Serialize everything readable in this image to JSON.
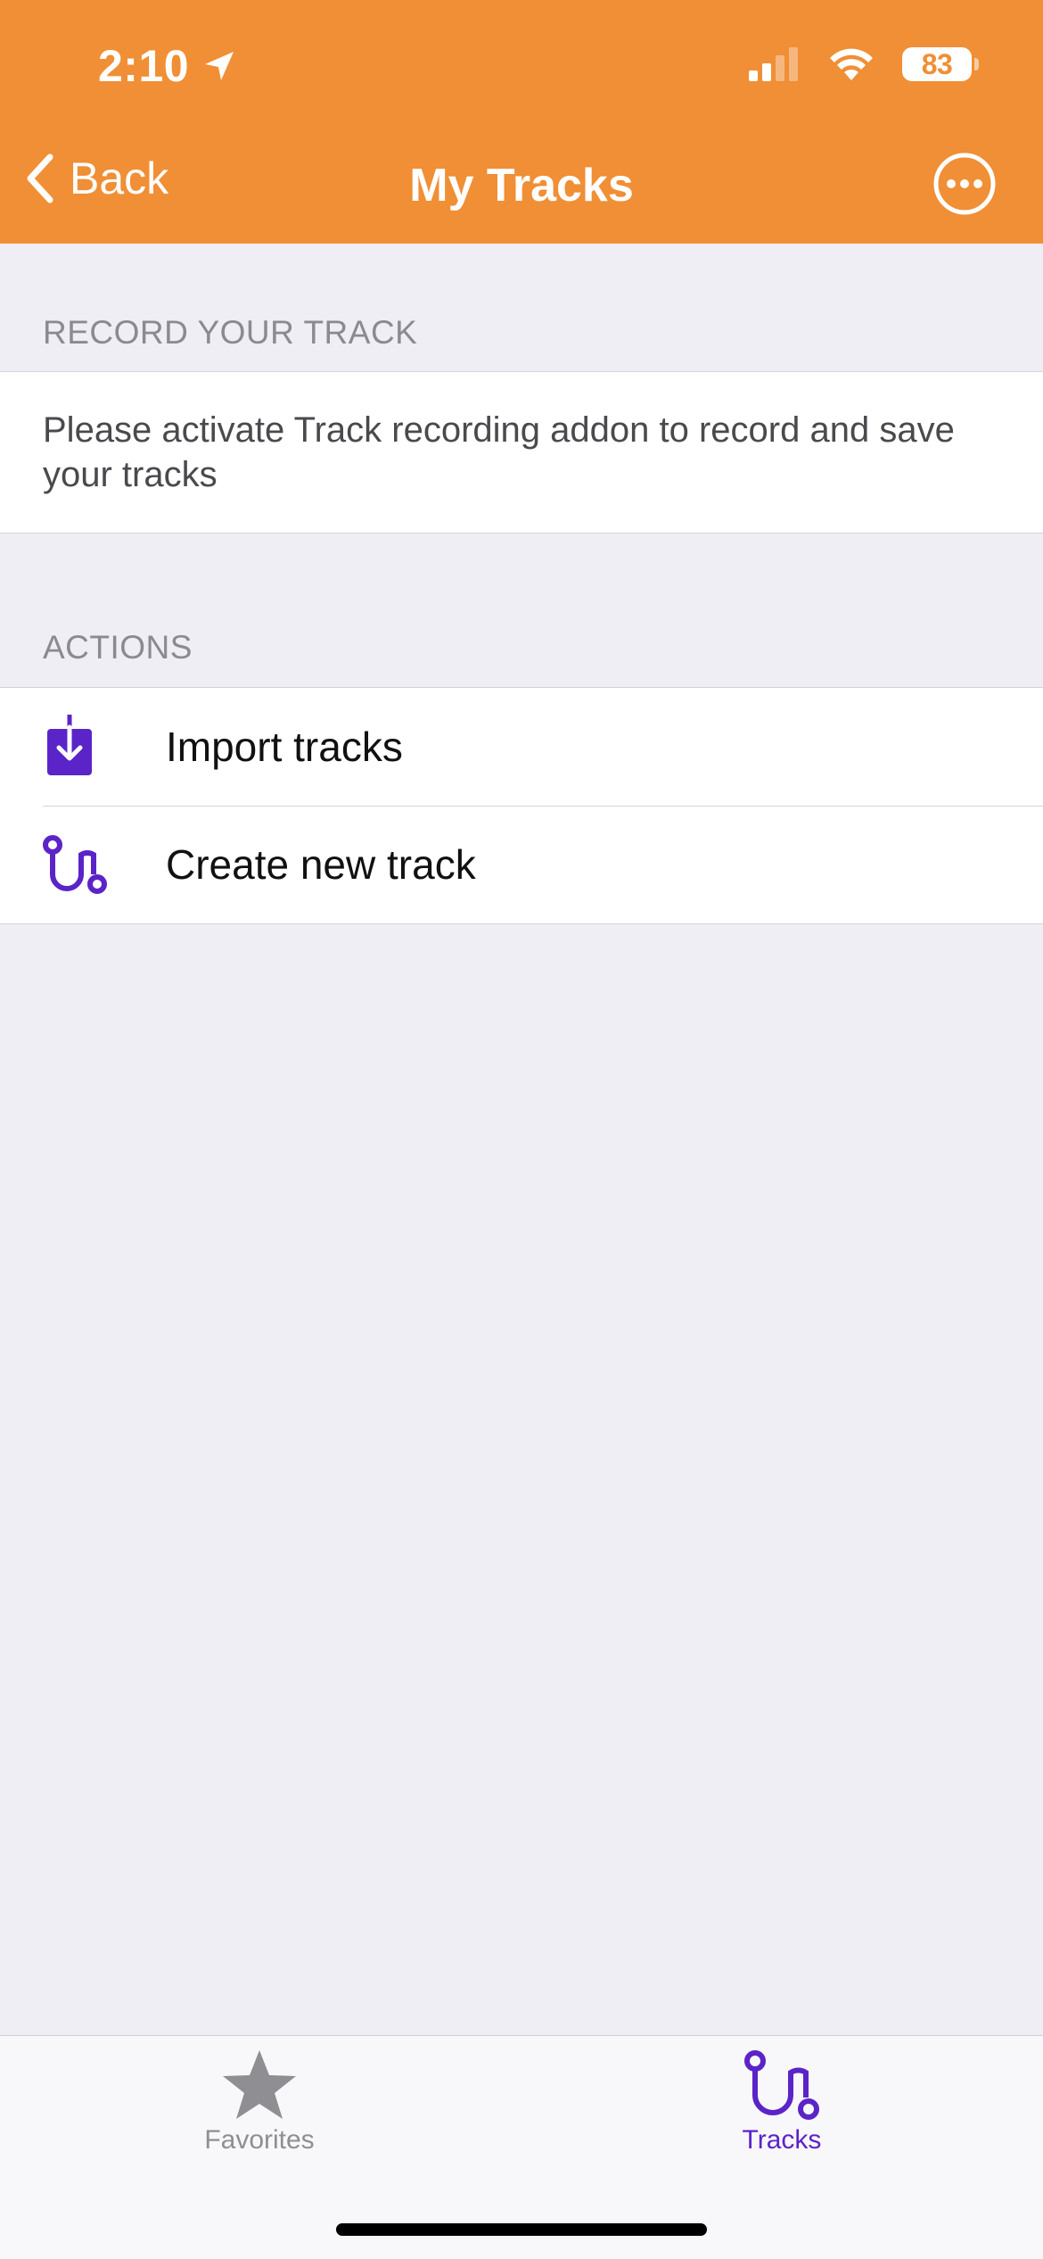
{
  "status_bar": {
    "time": "2:10",
    "battery": "83"
  },
  "nav": {
    "back_label": "Back",
    "title": "My Tracks"
  },
  "record_section": {
    "header": "RECORD YOUR TRACK",
    "note": "Please activate Track recording addon to record and save your tracks"
  },
  "actions_section": {
    "header": "ACTIONS",
    "items": [
      {
        "label": "Import tracks",
        "icon": "import-icon"
      },
      {
        "label": "Create new track",
        "icon": "route-icon"
      }
    ]
  },
  "tabbar": {
    "tabs": [
      {
        "label": "Favorites",
        "icon": "star-icon",
        "active": false
      },
      {
        "label": "Tracks",
        "icon": "route-icon",
        "active": true
      }
    ]
  },
  "colors": {
    "header": "#F08F35",
    "accent": "#5B24C8",
    "inactive": "#8E8E93",
    "background": "#EFEEF4"
  }
}
